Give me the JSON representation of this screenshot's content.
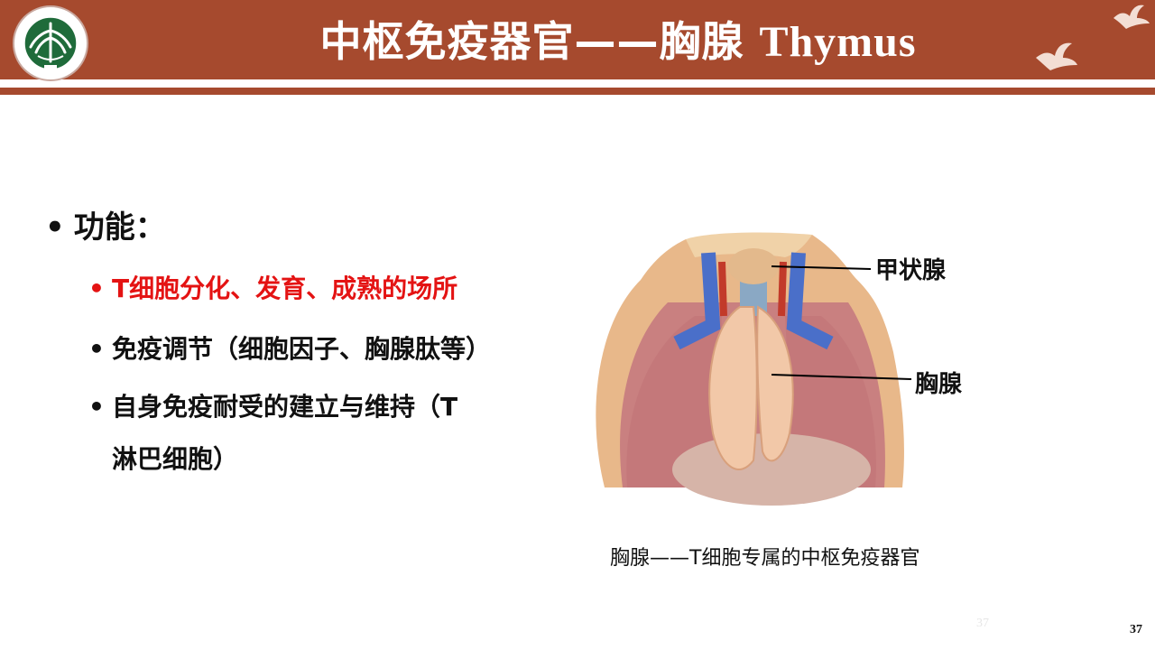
{
  "header": {
    "title_cn": "中枢免疫器官——胸腺",
    "title_en": "Thymus",
    "logo": {
      "icon": "university-seal-icon",
      "seal_text": "北京理工大学 BEIJING INSTITUTE OF TECHNOLOGY 1940"
    }
  },
  "content": {
    "heading": "功能：",
    "bullets": [
      {
        "text": "T细胞分化、发育、成熟的场所",
        "color": "#e41313"
      },
      {
        "text": "免疫调节（细胞因子、胸腺肽等）",
        "color": "#111111"
      },
      {
        "text_line1": "自身免疫耐受的建立与维持（T",
        "text_line2": "淋巴细胞）",
        "color": "#111111"
      }
    ]
  },
  "figure": {
    "label_thyroid": "甲状腺",
    "label_thymus": "胸腺",
    "caption": "胸腺——T细胞专属的中枢免疫器官"
  },
  "footer": {
    "ghost_number": "37",
    "page_number": "37"
  },
  "colors": {
    "brand": "#a64a2e",
    "accent_red": "#e41313"
  }
}
